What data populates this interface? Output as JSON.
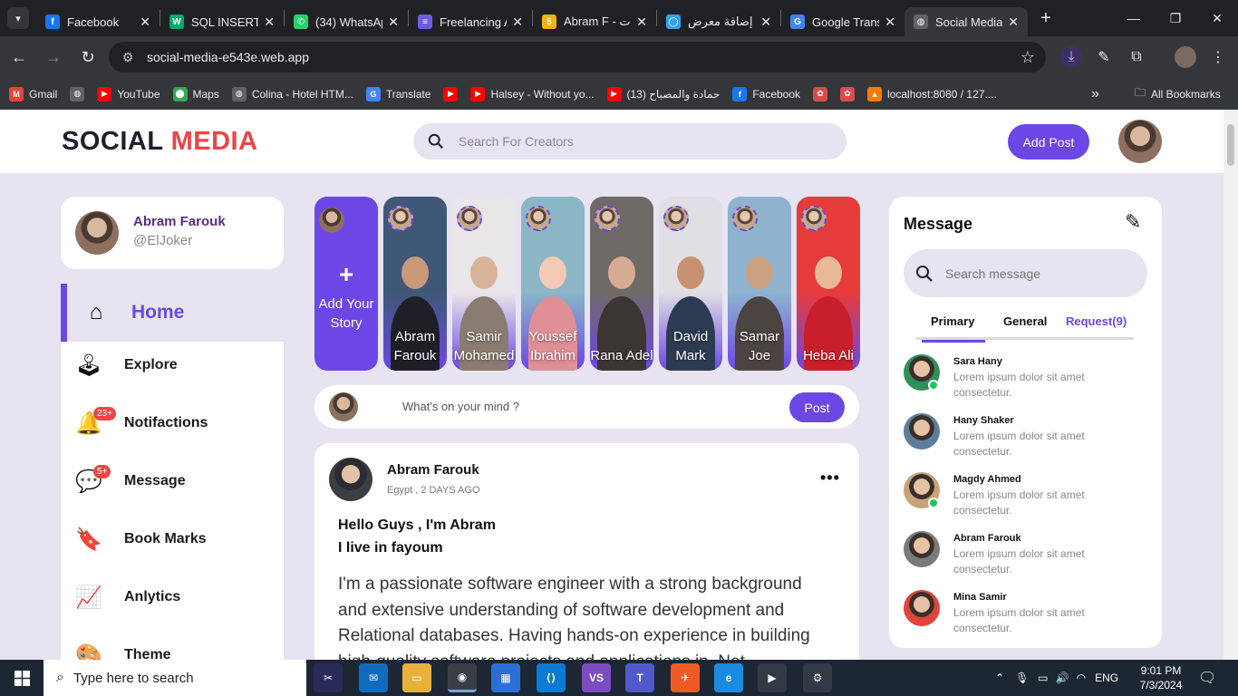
{
  "browser": {
    "tabs": [
      {
        "title": "Facebook",
        "icon": "facebook-icon",
        "color": "#1877f2",
        "glyph": "f"
      },
      {
        "title": "SQL INSERT I",
        "icon": "w3schools-icon",
        "color": "#04aa6d",
        "glyph": "W"
      },
      {
        "title": "(34) WhatsAp",
        "icon": "whatsapp-icon",
        "color": "#25d366",
        "glyph": "✆"
      },
      {
        "title": "Freelancing A",
        "icon": "freelancing-icon",
        "color": "#6c5ce7",
        "glyph": "≡"
      },
      {
        "title": "Abram F - ت.",
        "icon": "khamsat-icon",
        "color": "#f4b400",
        "glyph": "5"
      },
      {
        "title": "إضافة معرض",
        "icon": "mostaql-icon",
        "color": "#2ea3f2",
        "glyph": "◯"
      },
      {
        "title": "Google Trans",
        "icon": "google-translate-icon",
        "color": "#4285f4",
        "glyph": "G"
      },
      {
        "title": "Social Media",
        "icon": "globe-icon",
        "color": "#5f6368",
        "glyph": "◍"
      }
    ],
    "url": "social-media-e543e.web.app",
    "bookmarks": [
      {
        "label": "Gmail",
        "icon": "gmail-icon",
        "color": "#ea4335",
        "glyph": "M"
      },
      {
        "label": "",
        "icon": "globe-icon",
        "color": "#5f6368",
        "glyph": "◍"
      },
      {
        "label": "YouTube",
        "icon": "youtube-icon",
        "color": "#ff0000",
        "glyph": "▶"
      },
      {
        "label": "Maps",
        "icon": "maps-icon",
        "color": "#34a853",
        "glyph": "⬤"
      },
      {
        "label": "Colina - Hotel HTM...",
        "icon": "globe-icon",
        "color": "#5f6368",
        "glyph": "◍"
      },
      {
        "label": "Translate",
        "icon": "google-translate-icon",
        "color": "#4285f4",
        "glyph": "G"
      },
      {
        "label": "",
        "icon": "youtube-icon",
        "color": "#ff0000",
        "glyph": "▶"
      },
      {
        "label": "Halsey - Without yo...",
        "icon": "youtube-icon",
        "color": "#ff0000",
        "glyph": "▶"
      },
      {
        "label": "(13) حمادة والمصباح",
        "icon": "youtube-icon",
        "color": "#ff0000",
        "glyph": "▶"
      },
      {
        "label": "Facebook",
        "icon": "facebook-icon",
        "color": "#1877f2",
        "glyph": "f"
      },
      {
        "label": "",
        "icon": "tools-icon",
        "color": "#d94c4c",
        "glyph": "✿"
      },
      {
        "label": "",
        "icon": "tools-icon",
        "color": "#d94c4c",
        "glyph": "✿"
      },
      {
        "label": "localhost:8080 / 127....",
        "icon": "xampp-icon",
        "color": "#f57c00",
        "glyph": "▲"
      }
    ],
    "all_bookmarks": "All Bookmarks"
  },
  "app": {
    "logo_part1": "SOCIAL",
    "logo_part2": "MEDIA",
    "search_placeholder": "Search For Creators",
    "add_post": "Add Post",
    "profile": {
      "name": "Abram Farouk",
      "handle": "@ElJoker"
    },
    "sidebar": [
      {
        "label": "Home",
        "icon": "home-icon",
        "glyph": "⌂"
      },
      {
        "label": "Explore",
        "icon": "joystick-icon",
        "glyph": "🕹"
      },
      {
        "label": "Notifactions",
        "icon": "bell-icon",
        "glyph": "🔔",
        "badge": "23+"
      },
      {
        "label": "Message",
        "icon": "chat-icon",
        "glyph": "💬",
        "badge": "5+"
      },
      {
        "label": "Book Marks",
        "icon": "bookmark-icon",
        "glyph": "🔖"
      },
      {
        "label": "Anlytics",
        "icon": "chart-line-icon",
        "glyph": "📈"
      },
      {
        "label": "Theme",
        "icon": "palette-icon",
        "glyph": "🎨"
      }
    ],
    "stories": {
      "add_label": "Add Your Story",
      "items": [
        {
          "name": "Abram Farouk",
          "bg": "#3f5878",
          "skin": "#c99a78",
          "cloth": "#1f1f27"
        },
        {
          "name": "Samir Mohamed",
          "bg": "#e9e6ea",
          "skin": "#d9b29a",
          "cloth": "#8a7c72"
        },
        {
          "name": "Youssef Ibrahim",
          "bg": "#8ab6c6",
          "skin": "#f4c9b6",
          "cloth": "#e08f97"
        },
        {
          "name": "Rana Adel",
          "bg": "#6f6a66",
          "skin": "#d6ab92",
          "cloth": "#3c3633"
        },
        {
          "name": "David Mark",
          "bg": "#e0dfe3",
          "skin": "#c89272",
          "cloth": "#2d3b52"
        },
        {
          "name": "Samar Joe",
          "bg": "#8fb3cf",
          "skin": "#caa181",
          "cloth": "#4b4440"
        },
        {
          "name": "Heba Ali",
          "bg": "#e63b3b",
          "skin": "#e8b899",
          "cloth": "#c81f2a"
        }
      ]
    },
    "composer": {
      "placeholder": "What's on your mind ?",
      "button": "Post"
    },
    "post": {
      "author": "Abram Farouk",
      "meta": "Egypt , 2 DAYS AGO",
      "headline_line1": "Hello Guys , I'm Abram",
      "headline_line2": "I live in fayoum",
      "body": "I'm a passionate software engineer with a strong background and extensive understanding of software development and Relational databases. Having hands-on experience in building high-quality software projects and applications in .Net"
    },
    "messages": {
      "title": "Message",
      "search_placeholder": "Search message",
      "tabs": {
        "primary": "Primary",
        "general": "General",
        "request": "Request(9)"
      },
      "chats": [
        {
          "name": "Sara Hany",
          "text": "Lorem ipsum dolor sit amet consectetur.",
          "online": true,
          "color": "#2f8f5b"
        },
        {
          "name": "Hany Shaker",
          "text": "Lorem ipsum dolor sit amet consectetur.",
          "online": false,
          "color": "#5d7d99"
        },
        {
          "name": "Magdy Ahmed",
          "text": "Lorem ipsum dolor sit amet consectetur.",
          "online": true,
          "color": "#c9a27a"
        },
        {
          "name": "Abram Farouk",
          "text": "Lorem ipsum dolor sit amet consectetur.",
          "online": false,
          "color": "#7a7a7a"
        },
        {
          "name": "Mina Samir",
          "text": "Lorem ipsum dolor sit amet consectetur.",
          "online": false,
          "color": "#e0453a"
        }
      ]
    }
  },
  "taskbar": {
    "search_placeholder": "Type here to search",
    "apps": [
      {
        "name": "snipping-icon",
        "color": "#2b2b5a",
        "glyph": "✂"
      },
      {
        "name": "mail-icon",
        "color": "#0f6cbd",
        "glyph": "✉"
      },
      {
        "name": "folder-icon",
        "color": "#e8b23a",
        "glyph": "▭"
      },
      {
        "name": "chrome-icon",
        "color": "#3a3f47",
        "glyph": "◉"
      },
      {
        "name": "store-icon",
        "color": "#2a6fd6",
        "glyph": "▦"
      },
      {
        "name": "vscode-icon",
        "color": "#0a7bd3",
        "glyph": "⟨⟩"
      },
      {
        "name": "visual-studio-icon",
        "color": "#7d4cc2",
        "glyph": "VS"
      },
      {
        "name": "teams-icon",
        "color": "#5059c9",
        "glyph": "T"
      },
      {
        "name": "postman-icon",
        "color": "#ef5b25",
        "glyph": "✈"
      },
      {
        "name": "edge-icon",
        "color": "#1b8be0",
        "glyph": "e"
      },
      {
        "name": "media-player-icon",
        "color": "#333a45",
        "glyph": "▶"
      },
      {
        "name": "settings-icon",
        "color": "#333a45",
        "glyph": "⚙"
      }
    ],
    "lang": "ENG",
    "time": "9:01 PM",
    "date": "7/3/2024"
  }
}
